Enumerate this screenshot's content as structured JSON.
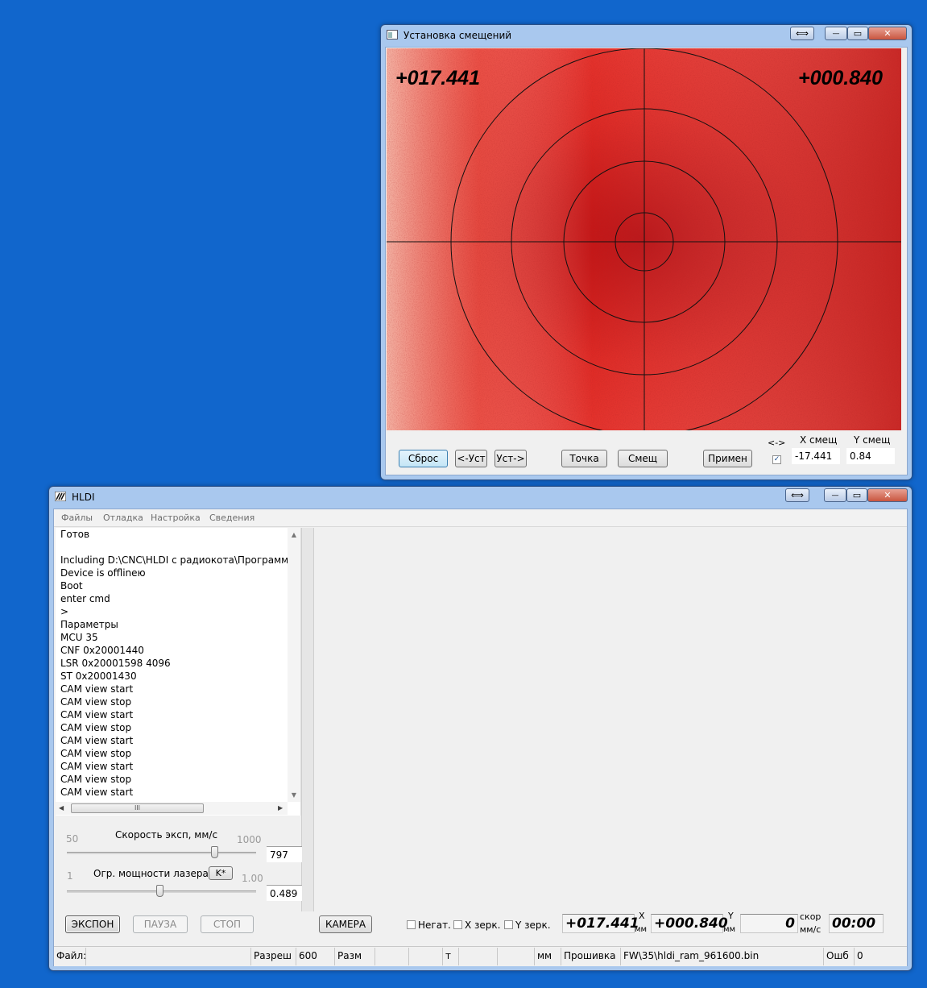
{
  "offset_window": {
    "title": "Установка смещений",
    "overlay_x": "+017.441",
    "overlay_y": "+000.840",
    "buttons": {
      "reset": "Сброс",
      "set_left": "<-Уст",
      "set_right": "Уст->",
      "point": "Точка",
      "offset": "Смещ",
      "apply": "Примен"
    },
    "swap_label": "<->",
    "x_offset_label": "X смещ",
    "y_offset_label": "Y смещ",
    "x_offset_value": "-17.441",
    "y_offset_value": "0.84",
    "swap_checked": true
  },
  "main_window": {
    "title": "HLDI",
    "menu": [
      "Файлы",
      "Отладка",
      "Настройка",
      "Сведения"
    ],
    "log": [
      "Готов",
      "",
      "Including D:\\CNC\\HLDI с радиокота\\Программа",
      "Device is offlineю",
      " Boot",
      "enter cmd",
      ">",
      "Параметры",
      "MCU 35",
      "CNF 0x20001440",
      "LSR 0x20001598 4096",
      " ST 0x20001430",
      "CAM view start",
      "CAM view stop",
      "CAM view start",
      "CAM view stop",
      "CAM view start",
      "CAM view stop",
      "CAM view start",
      "CAM view stop",
      "CAM view start"
    ],
    "hscroll_grip": "III",
    "speed": {
      "label": "Скорость эксп, мм/с",
      "min": "50",
      "max": "1000",
      "value": "797",
      "level": 0.79
    },
    "power": {
      "label": "Огр. мощности лазера,",
      "k_button": "K*",
      "max": "1.00",
      "value": "0.489",
      "level": 0.49
    },
    "buttons": {
      "expose": "ЭКСПОН",
      "pause": "ПАУЗА",
      "stop": "СТОП",
      "camera": "КАМЕРА"
    },
    "checks": {
      "negative": "Негат.",
      "x_mirror": "X зерк.",
      "y_mirror": "Y зерк."
    },
    "coord_x": "+017.441",
    "coord_x_axis": "X",
    "coord_x_unit": "мм",
    "coord_y": "+000.840",
    "coord_y_axis": "Y",
    "coord_y_unit": "мм",
    "speed_value": "0",
    "speed_label": "скор",
    "speed_unit": "мм/с",
    "time_value": "00:00",
    "status": {
      "file_label": "Файл:",
      "res_label": "Разреш",
      "res_value": "600",
      "size_label": "Разм",
      "t_label": "т",
      "mm_label": "мм",
      "fw_label": "Прошивка",
      "fw_value": "FW\\35\\hldi_ram_961600.bin",
      "err_label": "Ошб",
      "err_value": "0"
    }
  },
  "caption_glyphs": {
    "swap": "⟺",
    "minimize": "—",
    "maximize": "▭",
    "close": "✕"
  }
}
